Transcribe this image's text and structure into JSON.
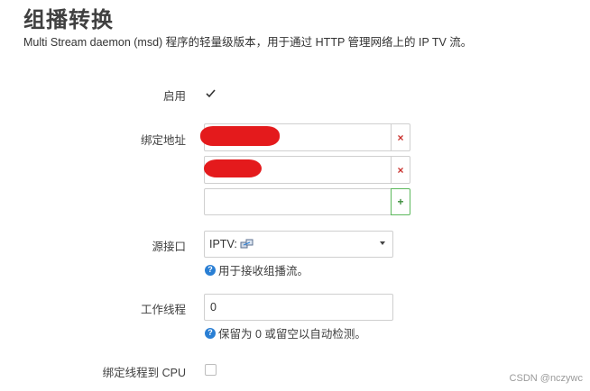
{
  "page": {
    "title": "组播转换",
    "description": "Multi Stream daemon (msd) 程序的轻量级版本，用于通过 HTTP 管理网络上的 IP TV 流。"
  },
  "form": {
    "enable": {
      "label": "启用",
      "checked": true
    },
    "bind_address": {
      "label": "绑定地址",
      "entries": [
        "",
        ""
      ],
      "new_entry": "",
      "remove_glyph": "×",
      "add_glyph": "+"
    },
    "source_interface": {
      "label": "源接口",
      "selected": "IPTV:",
      "help": "用于接收组播流。"
    },
    "threads": {
      "label": "工作线程",
      "value": "0",
      "help": "保留为 0 或留空以自动检测。"
    },
    "bind_cpu": {
      "label": "绑定线程到 CPU",
      "checked": false
    }
  },
  "watermark": "CSDN @nczywc",
  "colors": {
    "accent": "#2a7fd4",
    "remove": "#c9302c",
    "add": "#5cb85c",
    "redaction": "#e41a1c"
  },
  "icons": {
    "enable_check": "checkmark-icon",
    "interface_icon": "network-interface-icon",
    "help": "question-circle-icon"
  }
}
